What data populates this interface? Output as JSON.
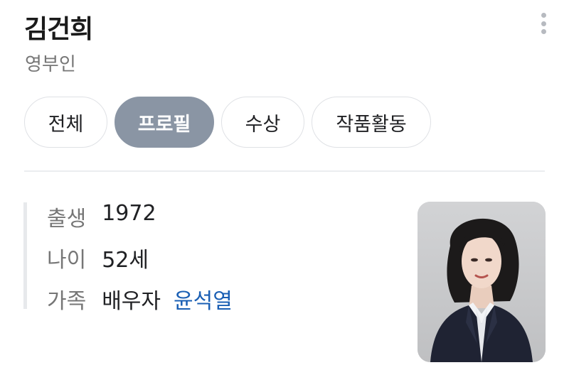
{
  "header": {
    "name": "김건희",
    "role": "영부인"
  },
  "tabs": [
    {
      "label": "전체",
      "active": false
    },
    {
      "label": "프로필",
      "active": true
    },
    {
      "label": "수상",
      "active": false
    },
    {
      "label": "작품활동",
      "active": false
    }
  ],
  "profile": {
    "birth_label": "출생",
    "birth_value": "1972",
    "age_label": "나이",
    "age_value": "52세",
    "family_label": "가족",
    "family_relation": "배우자",
    "family_name": "윤석열"
  },
  "icons": {
    "more": "more-vertical-icon"
  },
  "colors": {
    "active_tab": "#8a95a4",
    "link": "#1a5fb4",
    "label": "#767676"
  }
}
